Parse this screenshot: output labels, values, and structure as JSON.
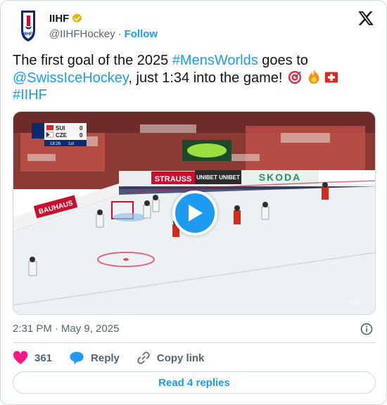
{
  "account": {
    "name": "IIHF",
    "handle": "@IIHFHockey",
    "separator": "·",
    "follow_label": "Follow",
    "verified_badge_color": "#e2b719",
    "avatar_logo_text": "IIHF"
  },
  "tweet": {
    "text_1": "The first goal of the 2025 ",
    "hashtag_1": "#MensWorlds",
    "text_2": " goes to ",
    "mention": "@SwissIceHockey",
    "text_3": ", just 1:34 into the game! ",
    "emojis": [
      "target-emoji",
      "fire-emoji",
      "swiss-flag-emoji"
    ],
    "hashtag_2": "#IIHF"
  },
  "media": {
    "type": "video",
    "scorebug": {
      "team_1": "SUI",
      "score_1": "0",
      "team_2": "CZE",
      "score_2": "0",
      "clock": "18:26",
      "period": "1st"
    },
    "boards": [
      "STRAUSS",
      "UNIBET",
      "UNIBET",
      "SKODA",
      "BAUHAUS"
    ],
    "watermark": "IIHF"
  },
  "meta": {
    "time": "2:31 PM",
    "separator": "·",
    "date": "May 9, 2025"
  },
  "actions": {
    "likes": "361",
    "reply_label": "Reply",
    "copy_link_label": "Copy link"
  },
  "read_replies_label": "Read 4 replies",
  "colors": {
    "accent": "#1d9bf0",
    "like": "#f91880",
    "text_secondary": "#536471",
    "border": "#cfd9de"
  }
}
